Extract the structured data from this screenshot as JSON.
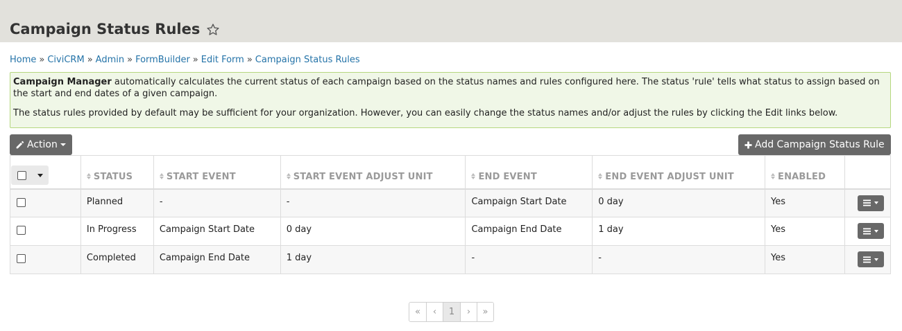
{
  "page": {
    "title": "Campaign Status Rules"
  },
  "breadcrumb": [
    {
      "label": "Home"
    },
    {
      "label": "CiviCRM"
    },
    {
      "label": "Admin"
    },
    {
      "label": "FormBuilder"
    },
    {
      "label": "Edit Form"
    },
    {
      "label": "Campaign Status Rules"
    }
  ],
  "breadcrumb_separator": "»",
  "help": {
    "strong": "Campaign Manager",
    "para1_rest": " automatically calculates the current status of each campaign based on the status names and rules configured here. The status 'rule' tells what status to assign based on the start and end dates of a given campaign.",
    "para2": "The status rules provided by default may be sufficient for your organization. However, you can easily change the status names and/or adjust the rules by clicking the Edit links below."
  },
  "toolbar": {
    "action_label": "Action",
    "add_label": "Add Campaign Status Rule"
  },
  "table": {
    "columns": [
      "STATUS",
      "START EVENT",
      "START EVENT ADJUST UNIT",
      "END EVENT",
      "END EVENT ADJUST UNIT",
      "ENABLED"
    ],
    "rows": [
      {
        "status": "Planned",
        "start_event": "-",
        "start_adjust": "-",
        "end_event": "Campaign Start Date",
        "end_adjust": "0 day",
        "enabled": "Yes"
      },
      {
        "status": "In Progress",
        "start_event": "Campaign Start Date",
        "start_adjust": "0 day",
        "end_event": "Campaign End Date",
        "end_adjust": "1 day",
        "enabled": "Yes"
      },
      {
        "status": "Completed",
        "start_event": "Campaign End Date",
        "start_adjust": "1 day",
        "end_event": "-",
        "end_adjust": "-",
        "enabled": "Yes"
      }
    ]
  },
  "pager": {
    "first": "«",
    "prev": "‹",
    "current": "1",
    "next": "›",
    "last": "»"
  },
  "colors": {
    "header_bg": "#e2e1dc",
    "link": "#2473a8",
    "help_bg": "#f0f7e7",
    "help_border": "#b5d77f",
    "button_bg": "#686868"
  },
  "icons": {
    "favorite": "star-outline-icon",
    "action": "pencil-icon",
    "add": "plus-icon",
    "row_menu": "bars-icon"
  }
}
